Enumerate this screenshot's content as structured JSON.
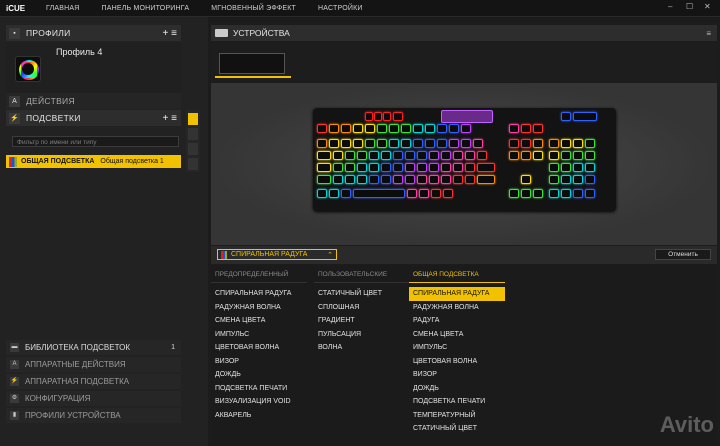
{
  "topbar": {
    "brand": "iCUE",
    "nav": [
      "ГЛАВНАЯ",
      "ПАНЕЛЬ МОНИТОРИНГА",
      "МГНОВЕННЫЙ ЭФФЕКТ",
      "НАСТРОЙКИ"
    ]
  },
  "window": {
    "minimize": "–",
    "maximize": "☐",
    "close": "✕"
  },
  "profiles": {
    "title": "ПРОФИЛИ",
    "actions": "+ ≡",
    "name": "Профиль 4"
  },
  "actions_section": {
    "title": "ДЕЙСТВИЯ"
  },
  "lighting": {
    "title": "ПОДСВЕТКИ",
    "actions": "+ ≡",
    "filter_placeholder": "Фильтр по имени или типу",
    "item_label": "ОБЩАЯ ПОДСВЕТКА",
    "item_name": "Общая подсветка 1"
  },
  "lower_sections": [
    {
      "label": "БИБЛИОТЕКА ПОДСВЕТОК",
      "count": "1",
      "icon": "folder-icon"
    },
    {
      "label": "АППАРАТНЫЕ ДЕЙСТВИЯ",
      "icon": "a-icon"
    },
    {
      "label": "АППАРАТНАЯ ПОДСВЕТКА",
      "icon": "bolt-icon"
    },
    {
      "label": "КОНФИГУРАЦИЯ",
      "icon": "gear-icon"
    },
    {
      "label": "ПРОФИЛИ УСТРОЙСТВА",
      "icon": "device-icon"
    }
  ],
  "devices": {
    "title": "УСТРОЙСТВА",
    "menu": "≡"
  },
  "effect": {
    "current": "СПИРАЛЬНАЯ РАДУГА",
    "cancel_label": "Отменить"
  },
  "effect_columns": [
    {
      "header": "ПРЕДОПРЕДЕЛЕННЫЙ",
      "items": [
        "СПИРАЛЬНАЯ РАДУГА",
        "РАДУЖНАЯ ВОЛНА",
        "СМЕНА ЦВЕТА",
        "ИМПУЛЬС",
        "ЦВЕТОВАЯ ВОЛНА",
        "ВИЗОР",
        "ДОЖДЬ",
        "ПОДСВЕТКА ПЕЧАТИ",
        "ВИЗУАЛИЗАЦИЯ VOID",
        "АКВАРЕЛЬ"
      ]
    },
    {
      "header": "ПОЛЬЗОВАТЕЛЬСКИЕ",
      "items": [
        "СТАТИЧНЫЙ ЦВЕТ",
        "СПЛОШНАЯ",
        "ГРАДИЕНТ",
        "ПУЛЬСАЦИЯ",
        "ВОЛНА"
      ]
    },
    {
      "header": "ОБЩАЯ ПОДСВЕТКА",
      "items": [
        "СПИРАЛЬНАЯ РАДУГА",
        "РАДУЖНАЯ ВОЛНА",
        "РАДУГА",
        "СМЕНА ЦВЕТА",
        "ИМПУЛЬС",
        "ЦВЕТОВАЯ ВОЛНА",
        "ВИЗОР",
        "ДОЖДЬ",
        "ПОДСВЕТКА ПЕЧАТИ",
        "ТЕМПЕРАТУРНЫЙ",
        "СТАТИЧНЫЙ ЦВЕТ"
      ]
    }
  ],
  "accent": "#f2c200",
  "watermark": "Avito"
}
